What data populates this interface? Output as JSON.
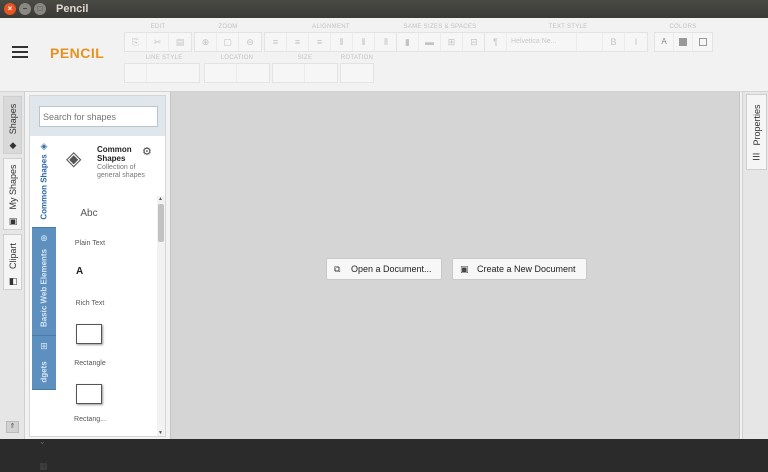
{
  "window": {
    "title": "Pencil",
    "controls": [
      "close-icon",
      "minimize-icon",
      "maximize-icon"
    ]
  },
  "header": {
    "logo": "PENCIL",
    "toolbar_groups": [
      {
        "label": "EDIT",
        "buttons": [
          "copy-icon",
          "cut-icon",
          "paste-icon"
        ]
      },
      {
        "label": "ZOOM",
        "buttons": [
          "zoom-in-icon",
          "zoom-reset-icon",
          "zoom-out-icon"
        ]
      },
      {
        "label": "ALIGNMENT",
        "buttons": [
          "align-left-icon",
          "align-center-icon",
          "align-right-icon",
          "align-top-icon",
          "align-middle-icon",
          "align-bottom-icon"
        ]
      },
      {
        "label": "SAME SIZES & SPACES",
        "buttons": [
          "same-width-icon",
          "same-height-icon",
          "h-space-icon",
          "v-space-icon"
        ]
      },
      {
        "label": "TEXT STYLE",
        "font_value": "Helvetica Ne...",
        "buttons": [
          "bold-icon",
          "italic-icon"
        ]
      },
      {
        "label": "COLORS",
        "buttons": [
          "text-color-icon",
          "fill-color-icon",
          "stroke-color-icon"
        ]
      },
      {
        "label": "LINE STYLE",
        "buttons": []
      },
      {
        "label": "LOCATION",
        "buttons": []
      },
      {
        "label": "SIZE",
        "buttons": []
      },
      {
        "label": "ROTATION",
        "buttons": []
      }
    ]
  },
  "left_tabs": [
    {
      "label": "Shapes",
      "icon": "shapes-icon"
    },
    {
      "label": "My Shapes",
      "icon": "my-shapes-icon"
    },
    {
      "label": "Clipart",
      "icon": "clipart-icon"
    }
  ],
  "panel": {
    "search_placeholder": "Search for shapes",
    "collection_tabs": [
      {
        "label": "Common Shapes",
        "icon": "layers-icon"
      },
      {
        "label": "Basic Web Elements",
        "icon": "globe-icon"
      },
      {
        "label": "dgets",
        "icon": "widget-grid-icon"
      }
    ],
    "collection": {
      "title": "Common Shapes",
      "description": "Collection of general shapes"
    },
    "shapes": [
      {
        "label": "Plain Text",
        "preview": "Abc"
      },
      {
        "label": "Rich Text",
        "preview": "A"
      },
      {
        "label": "Rectangle",
        "preview": ""
      },
      {
        "label": "Rectang...",
        "preview": ""
      }
    ]
  },
  "canvas": {
    "open_label": "Open a Document...",
    "create_label": "Create a New Document"
  },
  "right_tabs": [
    {
      "label": "Properties",
      "icon": "sliders-icon"
    }
  ]
}
